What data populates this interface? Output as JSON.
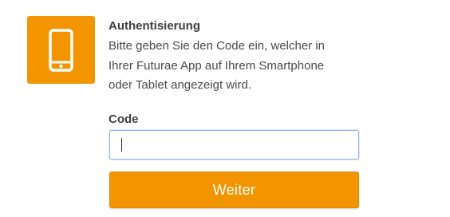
{
  "icon": "smartphone-icon",
  "colors": {
    "accent": "#f29500",
    "text": "#404040",
    "input_border": "#8ab4e6"
  },
  "auth": {
    "title": "Authentisierung",
    "description": "Bitte geben Sie den Code ein, welcher in Ihrer Futurae App auf Ihrem Smartphone oder Tablet angezeigt wird."
  },
  "form": {
    "code_label": "Code",
    "code_value": "",
    "submit_label": "Weiter"
  }
}
